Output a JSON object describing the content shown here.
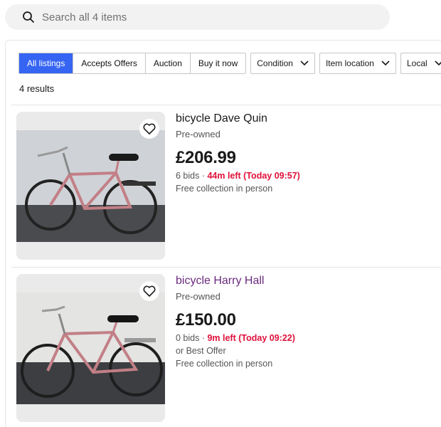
{
  "search": {
    "placeholder": "Search all 4 items"
  },
  "filters": {
    "segmented": [
      "All listings",
      "Accepts Offers",
      "Auction",
      "Buy it now"
    ],
    "dropdowns": [
      "Condition",
      "Item location",
      "Local"
    ]
  },
  "results_count": "4 results",
  "listings": [
    {
      "title": "bicycle Dave Quin",
      "condition": "Pre-owned",
      "price": "£206.99",
      "bids": "6 bids",
      "sep": " · ",
      "time_left": "44m left (Today 09:57)",
      "delivery": "Free collection in person"
    },
    {
      "title": "bicycle Harry Hall",
      "condition": "Pre-owned",
      "price": "£150.00",
      "bids": "0 bids",
      "sep": " · ",
      "time_left": "9m left (Today 09:22)",
      "offer": "or Best Offer",
      "delivery": "Free collection in person"
    }
  ],
  "colors": {
    "accent": "#3665f3",
    "urgent": "#e0103a",
    "visited_link": "#6b2a7f",
    "bike_frame": "#c27f86"
  },
  "icons": {
    "search": "search-icon",
    "heart": "heart-icon",
    "chevron": "chevron-down-icon"
  }
}
